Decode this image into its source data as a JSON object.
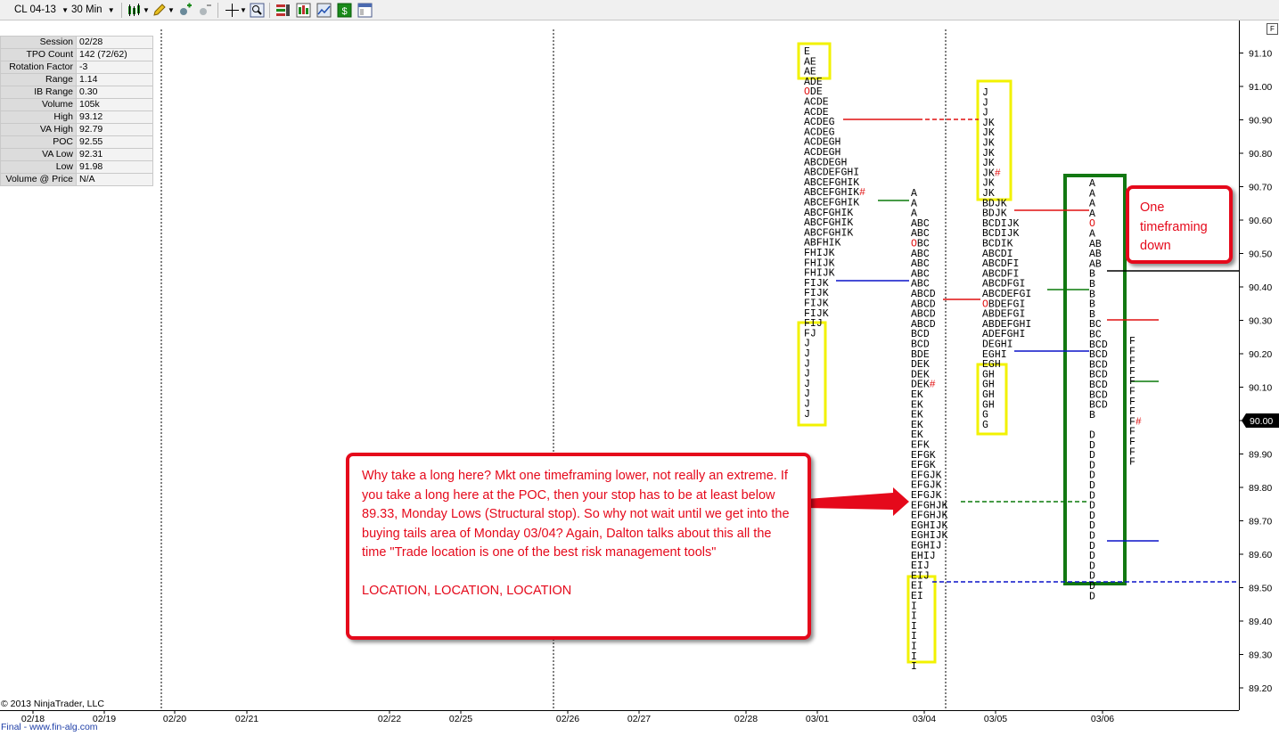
{
  "toolbar": {
    "instrument": "CL 04-13",
    "interval": "30 Min",
    "icons": [
      "candlestick-chart-icon",
      "pencil-draw-icon",
      "add-indicator-icon",
      "remove-indicator-icon",
      "crosshair-icon",
      "zoom-icon",
      "strategies-icon",
      "bar-type-icon",
      "chart-properties-icon",
      "money-icon",
      "data-box-icon"
    ]
  },
  "stats": [
    {
      "k": "Session",
      "v": "02/28"
    },
    {
      "k": "TPO Count",
      "v": "142 (72/62)"
    },
    {
      "k": "Rotation Factor",
      "v": "-3"
    },
    {
      "k": "Range",
      "v": "1.14"
    },
    {
      "k": "IB Range",
      "v": "0.30"
    },
    {
      "k": "Volume",
      "v": "105k"
    },
    {
      "k": "High",
      "v": "93.12"
    },
    {
      "k": "VA High",
      "v": "92.79"
    },
    {
      "k": "POC",
      "v": "92.55"
    },
    {
      "k": "VA Low",
      "v": "92.31"
    },
    {
      "k": "Low",
      "v": "91.98"
    },
    {
      "k": "Volume @ Price",
      "v": "N/A"
    }
  ],
  "y_axis": {
    "labels": [
      "91.10",
      "91.00",
      "90.90",
      "90.80",
      "90.70",
      "90.60",
      "90.50",
      "90.40",
      "90.30",
      "90.20",
      "90.10",
      "90.00",
      "89.90",
      "89.80",
      "89.70",
      "89.60",
      "89.50",
      "89.40",
      "89.30",
      "89.20"
    ],
    "current_price": "90.00"
  },
  "x_axis": {
    "labels": [
      "02/18",
      "02/19",
      "02/20",
      "02/21",
      "02/22",
      "02/25",
      "02/26",
      "02/27",
      "02/28",
      "03/01",
      "03/04",
      "03/05",
      "03/06"
    ]
  },
  "profiles": {
    "p0301": [
      "E",
      "AE",
      "AE",
      "ADE",
      "ODE",
      "ACDE",
      "ACDE",
      "ACDEG",
      "ACDEG",
      "ACDEGH",
      "ACDEGH",
      "ABCDEGH",
      "ABCDEFGHI",
      "ABCEFGHIK",
      "ABCEFGHIK#",
      "ABCEFGHIK",
      "ABCFGHIK",
      "ABCFGHIK",
      "ABCFGHIK",
      "ABFHIK",
      "FHIJK",
      "FHIJK",
      "FHIJK",
      "FIJK",
      "FIJK",
      "FIJK",
      "FIJK",
      "FIJ",
      "FJ",
      "J",
      "J",
      "J",
      "J",
      "J",
      "J",
      "J",
      "J"
    ],
    "p0304": [
      "A",
      "A",
      "A",
      "ABC",
      "ABC",
      "OBC",
      "ABC",
      "ABC",
      "ABC",
      "ABC",
      "ABCD",
      "ABCD",
      "ABCD",
      "ABCD",
      "BCD",
      "BCD",
      "BDE",
      "DEK",
      "DEK",
      "DEK#",
      "EK",
      "EK",
      "EK",
      "EK",
      "EK",
      "EFK",
      "EFGK",
      "EFGK",
      "EFGJK",
      "EFGJK",
      "EFGJK",
      "EFGHJK",
      "EFGHJK",
      "EGHIJK",
      "EGHIJK",
      "EGHIJ",
      "EHIJ",
      "EIJ",
      "EIJ",
      "EI",
      "EI",
      "I",
      "I",
      "I",
      "I",
      "I",
      "I",
      "I"
    ],
    "p0305": [
      "J",
      "J",
      "J",
      "JK",
      "JK",
      "JK",
      "JK",
      "JK",
      "JK#",
      "JK",
      "JK",
      "BDJK",
      "BDJK",
      "BCDIJK",
      "BCDIJK",
      "BCDIK",
      "ABCDI",
      "ABCDFI",
      "ABCDFI",
      "ABCDFGI",
      "ABCDEFGI",
      "OBDEFGI",
      "ABDEFGI",
      "ABDEFGHI",
      "ADEFGHI",
      "DEGHI",
      "EGHI",
      "EGH",
      "GH",
      "GH",
      "GH",
      "GH",
      "G",
      "G"
    ],
    "p0306": [
      "A",
      "A",
      "A",
      "A",
      "O",
      "A",
      "AB",
      "AB",
      "AB",
      "B",
      "B",
      "B",
      "B",
      "B",
      "BC",
      "BC",
      "BCD",
      "BCD",
      "BCD",
      "BCD",
      "BCD",
      "BCD",
      "BCD",
      "B",
      "",
      "D",
      "D",
      "D",
      "D",
      "D",
      "D",
      "D",
      "D",
      "D",
      "D",
      "D",
      "D",
      "D",
      "D",
      "D",
      "D",
      "D"
    ],
    "p0306b": [
      "F",
      "F",
      "F",
      "F",
      "F",
      "F",
      "F",
      "F",
      "F#",
      "F",
      "F",
      "F",
      "F"
    ]
  },
  "callouts": {
    "main": "Why take a long here? Mkt one timeframing lower, not really an extreme. If you take a long here at the POC, then your stop has to be at least below 89.33, Monday Lows (Structural stop). So why not wait until we get into the buying tails area of Monday 03/04? Again, Dalton talks about this all the time \"Trade location is one of the best risk management tools\"",
    "location": "LOCATION, LOCATION, LOCATION",
    "small": "One timeframing down"
  },
  "footer": {
    "copyright": "© 2013 NinjaTrader, LLC",
    "source": "Final - www.fin-alg.com"
  },
  "colors": {
    "callout": "#e5091b",
    "highlight_yellow": "#f2f200",
    "highlight_green": "#127812",
    "poc_red": "#e01010",
    "va_green": "#0a7a0a",
    "va_blue": "#0a12c8"
  }
}
